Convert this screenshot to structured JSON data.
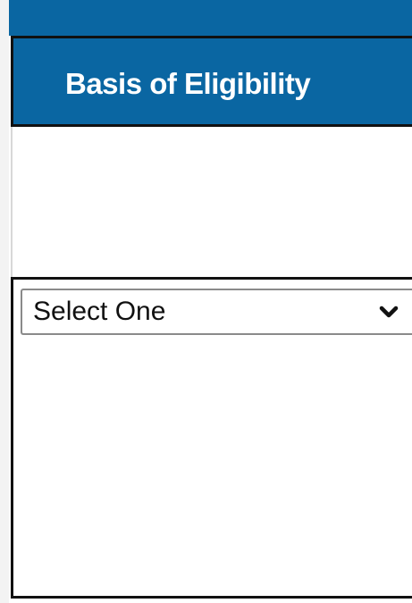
{
  "table": {
    "header": {
      "column_label": "Basis of Eligibility"
    },
    "select": {
      "selected_value": "Select One",
      "dropdown_icon": "chevron-down-icon"
    }
  },
  "colors": {
    "header_background": "#0a66a2",
    "header_text": "#ffffff",
    "border": "#111111"
  }
}
